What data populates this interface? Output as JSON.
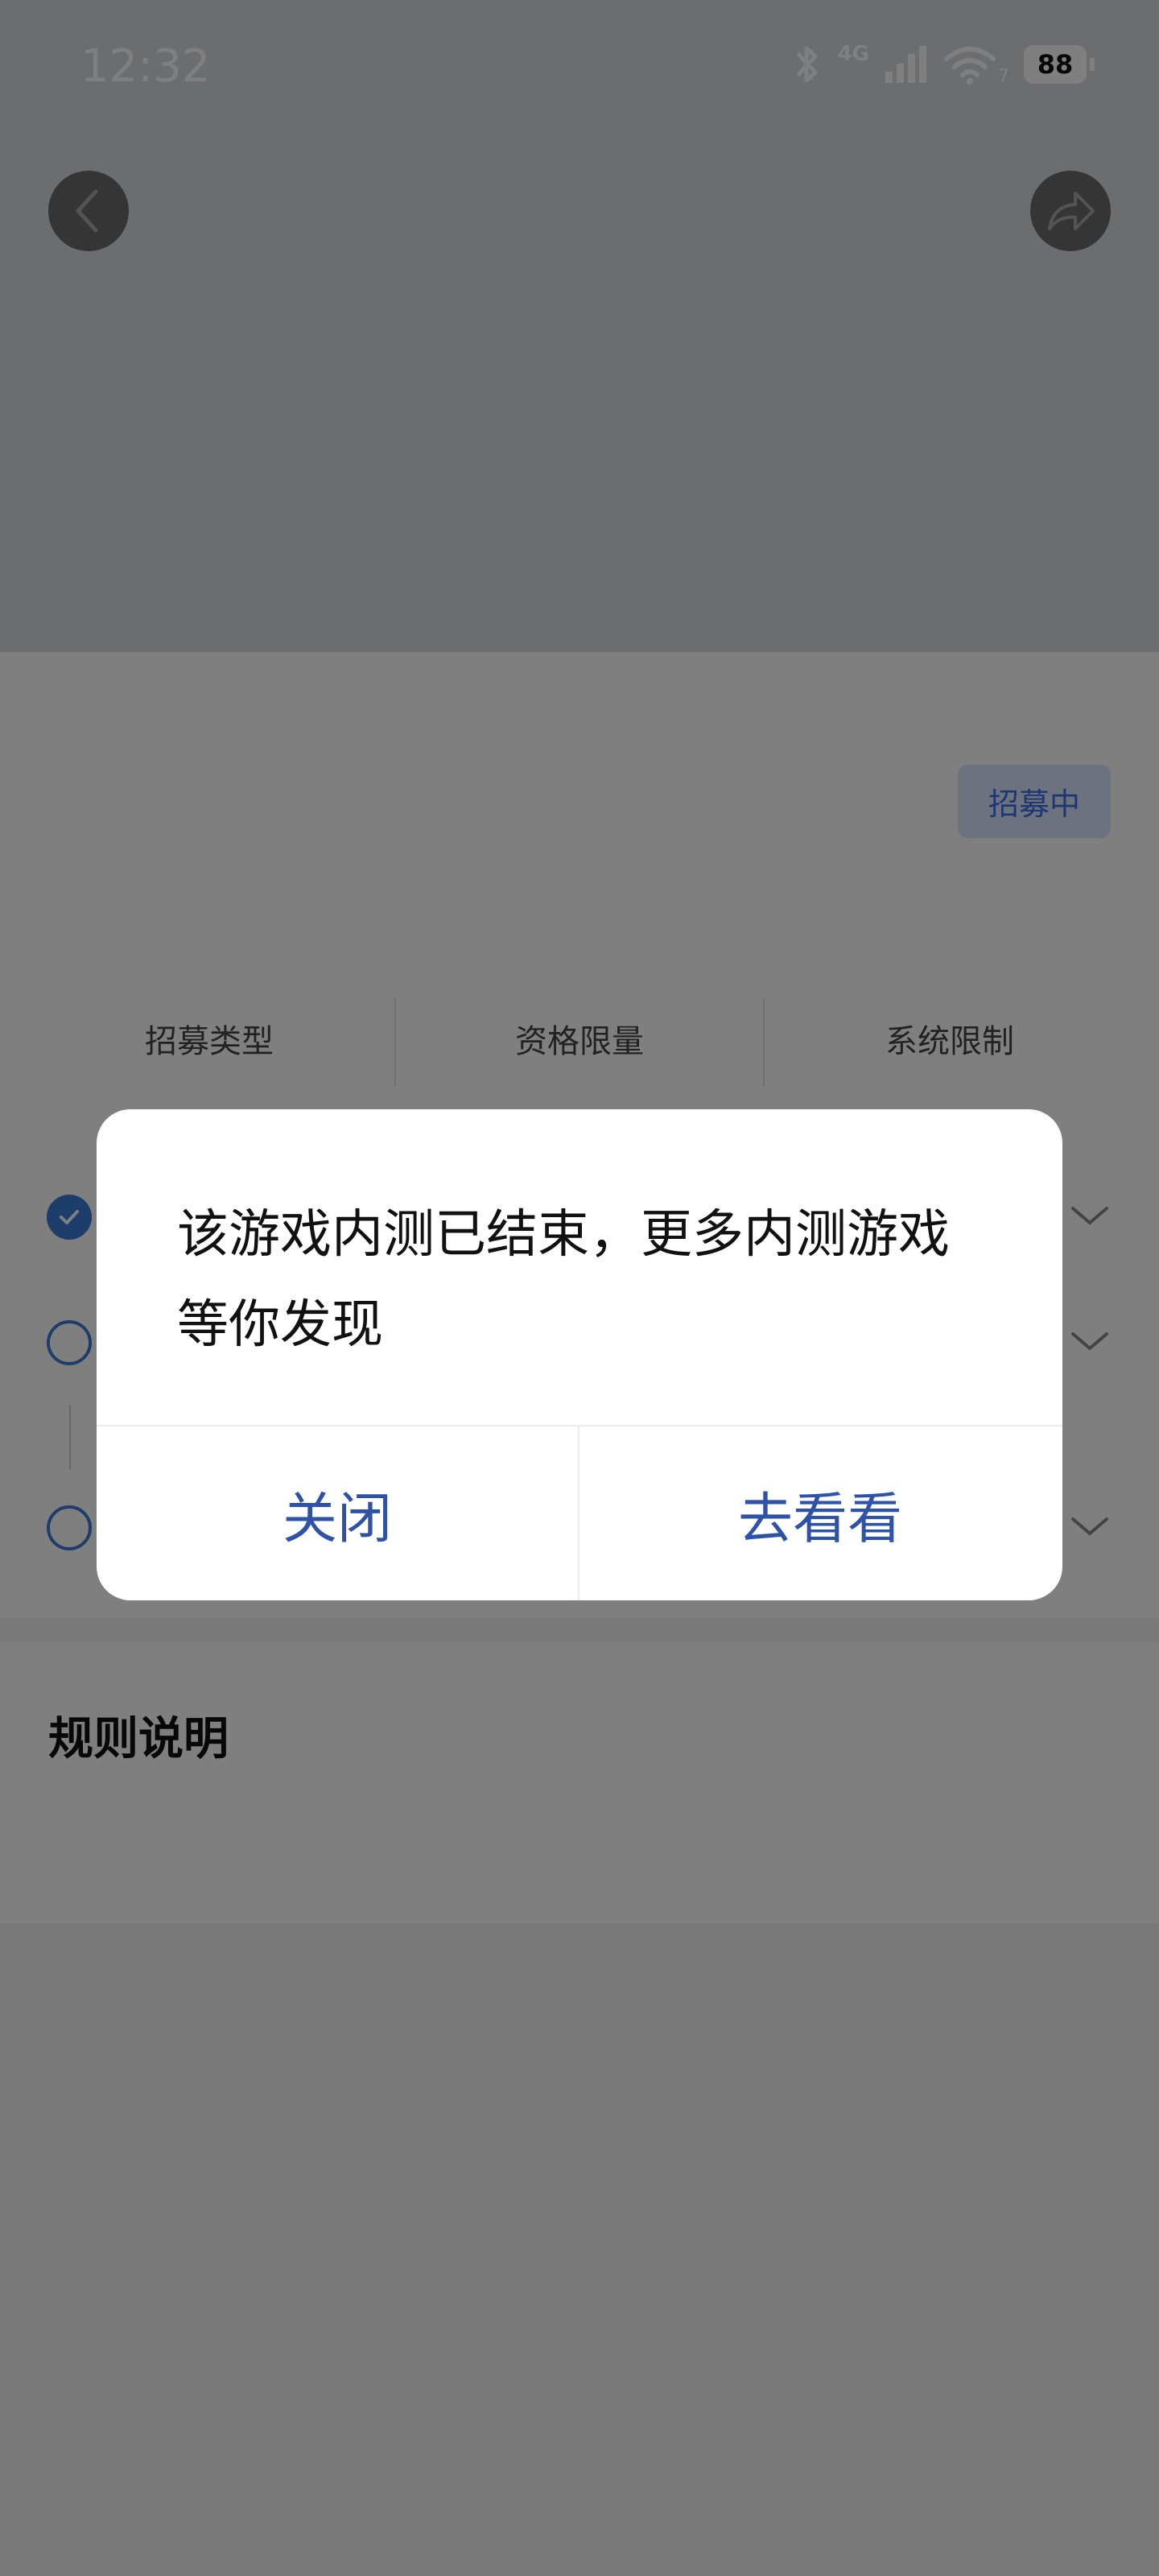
{
  "status_bar": {
    "time": "12:32",
    "network": "4G",
    "wifi_suffix": "7",
    "battery": "88",
    "icons": [
      "bluetooth-icon",
      "signal-icon",
      "wifi-icon",
      "battery-icon"
    ]
  },
  "top_actions": {
    "back_icon": "chevron-left-icon",
    "share_icon": "share-arrow-icon"
  },
  "status_badge": "招募中",
  "tabs": [
    "招募类型",
    "资格限量",
    "系统限制"
  ],
  "rules": {
    "title": "规则说明"
  },
  "dialog": {
    "message": "该游戏内测已结束，更多内测游戏等你发现",
    "close_label": "关闭",
    "goto_label": "去看看"
  },
  "colors": {
    "accent": "#3a7bd5",
    "dialog_button_text": "#2e52a6",
    "badge_bg": "#d9e6ff",
    "scrim": "rgba(0,0,0,0.5)"
  }
}
